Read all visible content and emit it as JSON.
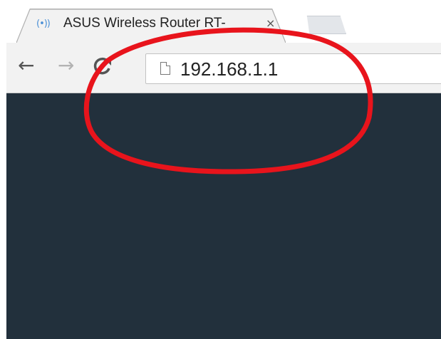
{
  "tab": {
    "favicon": "(•))",
    "title": "ASUS Wireless Router RT-",
    "close": "×"
  },
  "toolbar": {
    "back": "←",
    "forward": "→",
    "reload": "C"
  },
  "omnibox": {
    "url": "192.168.1.1"
  },
  "icons": {
    "tab_favicon": "wifi-icon",
    "page": "page-icon",
    "annotation": "red-ellipse-annotation"
  },
  "colors": {
    "content_bg": "#22303c",
    "annotation": "#e8141c",
    "favicon": "#4a8fd6"
  }
}
